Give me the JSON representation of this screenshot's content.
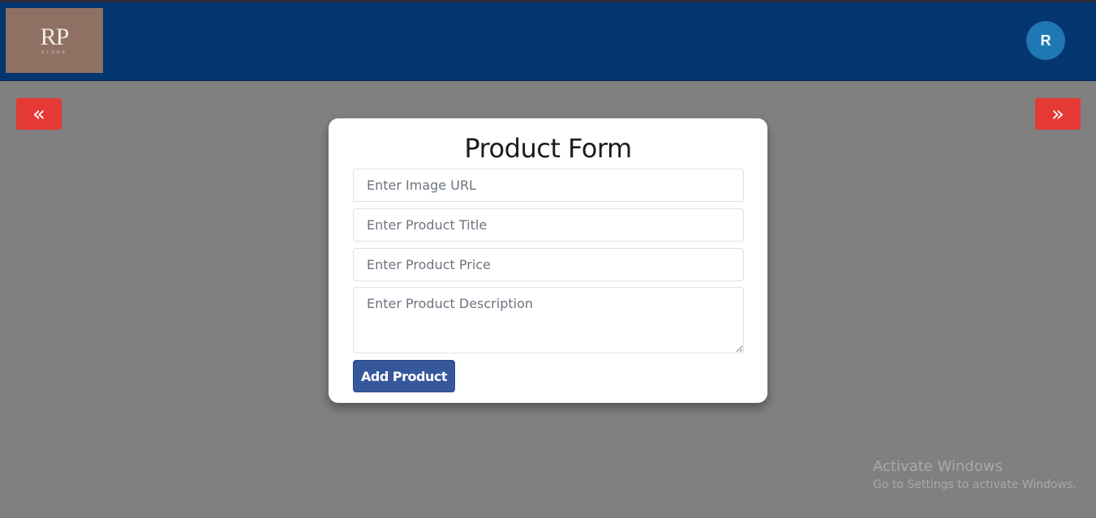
{
  "header": {
    "logo": {
      "mark": "RP",
      "sub": "STORE"
    },
    "avatar_initial": "R"
  },
  "navigation": {
    "prev_icon": "«",
    "next_icon": "»"
  },
  "form": {
    "title": "Product Form",
    "image_url_placeholder": "Enter Image URL",
    "title_placeholder": "Enter Product Title",
    "price_placeholder": "Enter Product Price",
    "description_placeholder": "Enter Product Description",
    "submit_label": "Add Product"
  },
  "watermark": {
    "title": "Activate Windows",
    "subtitle": "Go to Settings to activate Windows."
  },
  "colors": {
    "navbar": "#043670",
    "nav_button": "#e53935",
    "avatar": "#1f78b4",
    "submit_button": "#36579c",
    "backdrop": "#808080"
  }
}
